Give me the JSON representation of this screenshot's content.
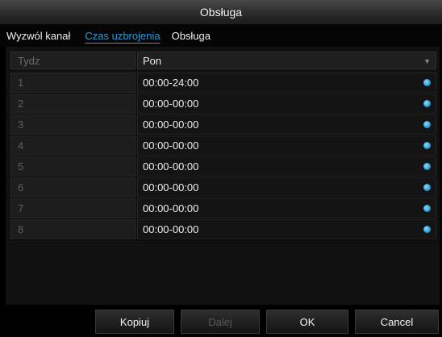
{
  "window": {
    "title": "Obsługa"
  },
  "tabs": [
    {
      "label": "Wyzwól kanał",
      "active": false
    },
    {
      "label": "Czas uzbrojenia",
      "active": true
    },
    {
      "label": "Obsługa",
      "active": false
    }
  ],
  "schedule": {
    "column_label": "Tydz",
    "day_selected": "Pon",
    "rows": [
      {
        "index": "1",
        "time": "00:00-24:00"
      },
      {
        "index": "2",
        "time": "00:00-00:00"
      },
      {
        "index": "3",
        "time": "00:00-00:00"
      },
      {
        "index": "4",
        "time": "00:00-00:00"
      },
      {
        "index": "5",
        "time": "00:00-00:00"
      },
      {
        "index": "6",
        "time": "00:00-00:00"
      },
      {
        "index": "7",
        "time": "00:00-00:00"
      },
      {
        "index": "8",
        "time": "00:00-00:00"
      }
    ]
  },
  "buttons": {
    "copy": "Kopiuj",
    "next": "Dalej",
    "ok": "OK",
    "cancel": "Cancel"
  },
  "colors": {
    "accent": "#2a9ad6",
    "disabled_text": "#5a5a5a"
  }
}
